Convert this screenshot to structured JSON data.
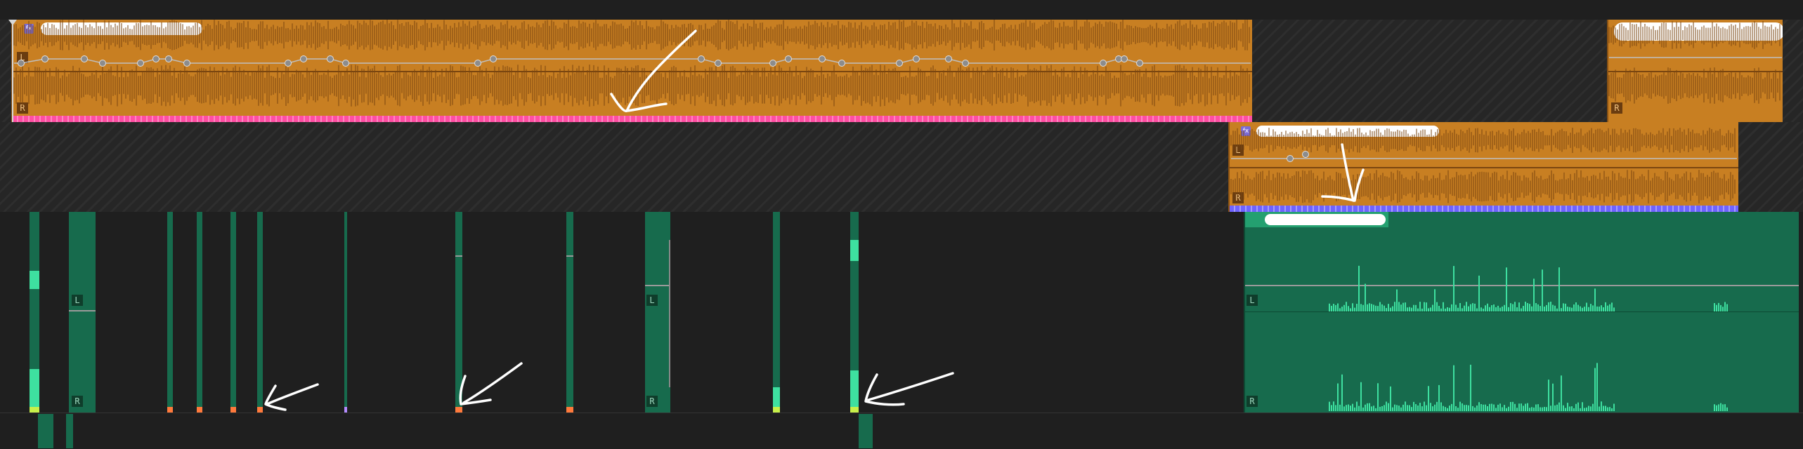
{
  "timeline": {
    "channel_left_label": "L",
    "channel_right_label": "R",
    "fx_badge": "fx"
  },
  "colors": {
    "background": "#1f1f1f",
    "audio_clip_orange": "#c87f22",
    "audio_clip_green": "#176b4d",
    "waveform_green": "#3ee0a0",
    "selection_bar_pink": "#ff4fa3",
    "selection_bar_blue": "#6f63ff"
  },
  "icons": [
    "fx-badge-icon",
    "playhead-marker-icon",
    "keyframe-node-icon"
  ],
  "annotations": [
    "hand-drawn-arrow",
    "hand-drawn-arrow",
    "hand-drawn-arrow",
    "hand-drawn-arrow",
    "hand-drawn-arrow",
    "redaction-scribble"
  ]
}
